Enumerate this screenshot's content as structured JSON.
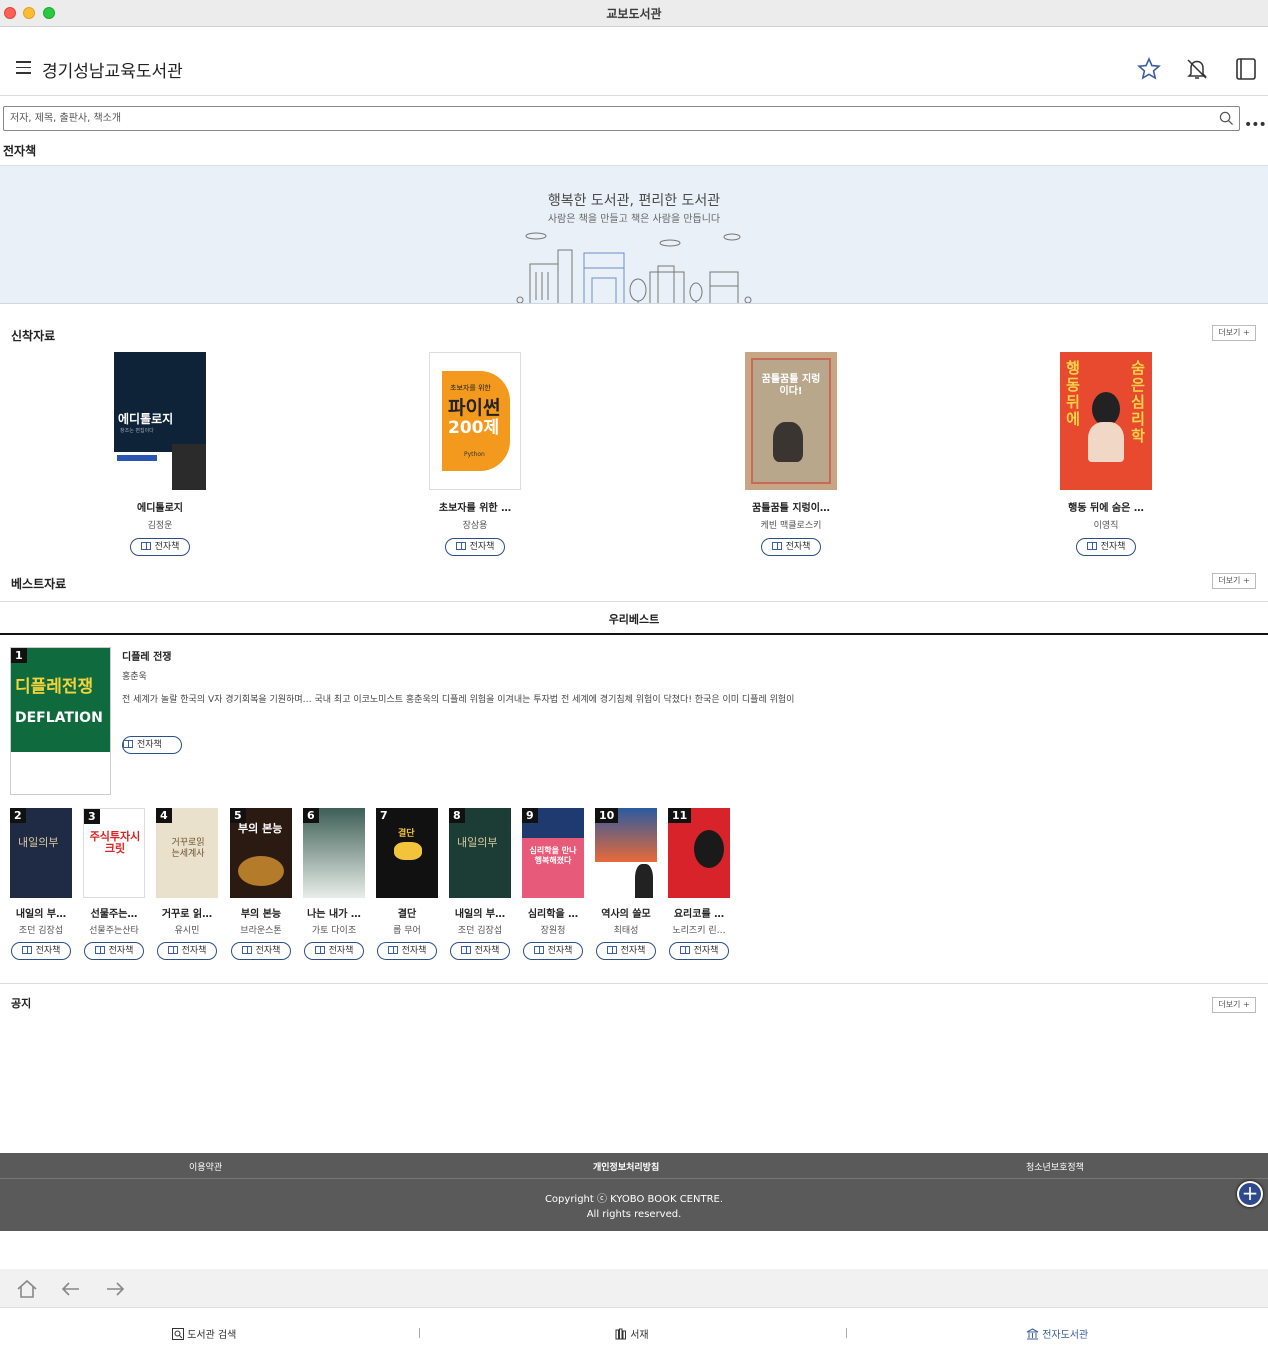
{
  "window": {
    "title": "교보도서관"
  },
  "header": {
    "library_name": "경기성남교육도서관"
  },
  "search": {
    "placeholder": "저자, 제목, 출판사, 책소개"
  },
  "ebook_section_label": "전자책",
  "banner": {
    "title": "행복한 도서관, 편리한 도서관",
    "subtitle": "사람은 책을 만들고 책은 사람을 만듭니다"
  },
  "new_arrivals": {
    "title": "신착자료",
    "more_label": "더보기 +",
    "books": [
      {
        "title": "에디톨로지",
        "author": "김정운",
        "button": "전자책"
      },
      {
        "title": "초보자를 위한 …",
        "author": "장삼용",
        "button": "전자책"
      },
      {
        "title": "꿈틀꿈틀 지렁이…",
        "author": "케빈 맥클로스키",
        "button": "전자책"
      },
      {
        "title": "행동 뒤에 숨은 …",
        "author": "이영직",
        "button": "전자책"
      }
    ]
  },
  "best": {
    "title": "베스트자료",
    "more_label": "더보기 +",
    "tab": "우리베스트",
    "top": {
      "rank": "1",
      "title": "디플레 전쟁",
      "author": "홍춘욱",
      "description": "전 세계가 놀랄 한국의 V자 경기회복을 기원하며… 국내 최고 이코노미스트 홍춘욱의 디플레 위험을 이겨내는 투자법 전 세계에 경기침체 위험이 닥쳤다! 한국은 이미 디플레 위험이",
      "button": "전자책"
    },
    "books": [
      {
        "rank": "2",
        "title": "내일의 부…",
        "author": "조던 김장섭",
        "button": "전자책"
      },
      {
        "rank": "3",
        "title": "선물주는…",
        "author": "선물주는산타",
        "button": "전자책"
      },
      {
        "rank": "4",
        "title": "거꾸로 읽…",
        "author": "유시민",
        "button": "전자책"
      },
      {
        "rank": "5",
        "title": "부의 본능",
        "author": "브라운스톤",
        "button": "전자책"
      },
      {
        "rank": "6",
        "title": "나는 내가 …",
        "author": "가토 다이조",
        "button": "전자책"
      },
      {
        "rank": "7",
        "title": "결단",
        "author": "롭 무어",
        "button": "전자책"
      },
      {
        "rank": "8",
        "title": "내일의 부…",
        "author": "조던 김장섭",
        "button": "전자책"
      },
      {
        "rank": "9",
        "title": "심리학을 …",
        "author": "장원청",
        "button": "전자책"
      },
      {
        "rank": "10",
        "title": "역사의 쓸모",
        "author": "최태성",
        "button": "전자책"
      },
      {
        "rank": "11",
        "title": "요리코를 …",
        "author": "노리즈키 린…",
        "button": "전자책"
      }
    ]
  },
  "notice": {
    "title": "공지",
    "more_label": "더보기 +"
  },
  "footer": {
    "links": [
      "이용약관",
      "개인정보처리방침",
      "청소년보호정책"
    ],
    "copyright_line1": "Copyright ⓒ KYOBO BOOK CENTRE.",
    "copyright_line2": "All rights reserved."
  },
  "bottom_tabs": {
    "search": "도서관 검색",
    "shelf": "서재",
    "ebook_library": "전자도서관"
  },
  "cover_text": {
    "editology_main": "에디톨로지",
    "editology_sub": "창조는 편집이다",
    "python_small": "초보자를 위한",
    "python_main": "파이썬",
    "python_num": "200제",
    "python_word": "Python",
    "worm": "꿈틀꿈틀 지렁이다!",
    "behavior_left": "행동뒤에",
    "behavior_right": "숨은심리학",
    "deflation_kr": "디플레전쟁",
    "deflation_en": "DEFLATION",
    "c2": "내일의부",
    "c3": "주식투자시크릿",
    "c4": "거꾸로읽는세계사",
    "c5": "부의 본능",
    "c7": "결단",
    "c8": "내일의부",
    "c9": "심리학을 만나 행복해졌다"
  },
  "colors": {
    "accent": "#2f4a8c",
    "ebook_tab_active": "#3a5fa0",
    "banner_bg": "#e9f0f7",
    "footer_bg": "#5a5a5a"
  }
}
